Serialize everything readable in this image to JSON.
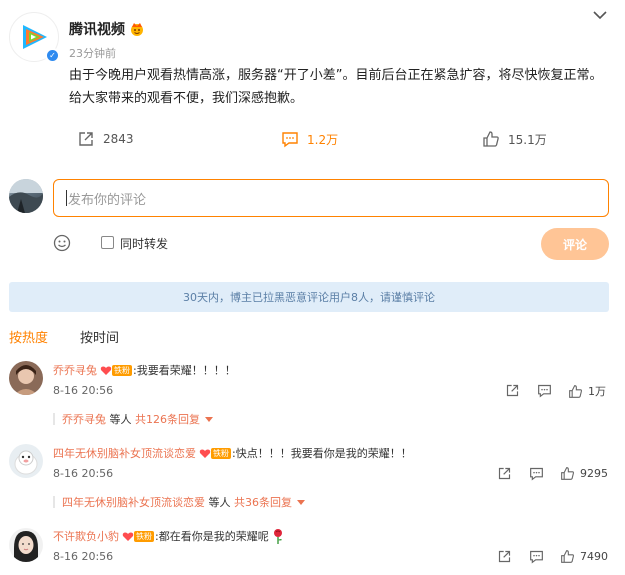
{
  "post": {
    "author": "腾讯视频",
    "time": "23分钟前",
    "text": "由于今晚用户观看热情高涨，服务器“开了小差”。目前后台正在紧急扩容，将尽快恢复正常。 给大家带来的观看不便，我们深感抱歉。",
    "repost_count": "2843",
    "comment_count": "1.2万",
    "like_count": "15.1万"
  },
  "composer": {
    "placeholder": "发布你的评论",
    "repost_label": "同时转发",
    "submit_label": "评论"
  },
  "notice": "30天内，博主已拉黑恶意评论用户8人，请谨慎评论",
  "sort": {
    "hot": "按热度",
    "time": "按时间"
  },
  "fan_tag": "铁粉",
  "comments": [
    {
      "name": "乔乔寻兔",
      "text": ":我要看荣耀！！！！",
      "time": "8-16 20:56",
      "likes": "1万",
      "reply_name": "乔乔寻兔",
      "reply_mid": " 等人 ",
      "reply_count": "共126条回复"
    },
    {
      "name": "四年无休别脑补女顶流谈恋爱",
      "text": ":快点！！！我要看你是我的荣耀！！",
      "time": "8-16 20:56",
      "likes": "9295",
      "reply_name": "四年无休别脑补女顶流谈恋爱",
      "reply_mid": " 等人 ",
      "reply_count": "共36条回复"
    },
    {
      "name": "不许欺负小豹",
      "text": ":都在看你是我的荣耀呢",
      "time": "8-16 20:56",
      "likes": "7490"
    }
  ]
}
